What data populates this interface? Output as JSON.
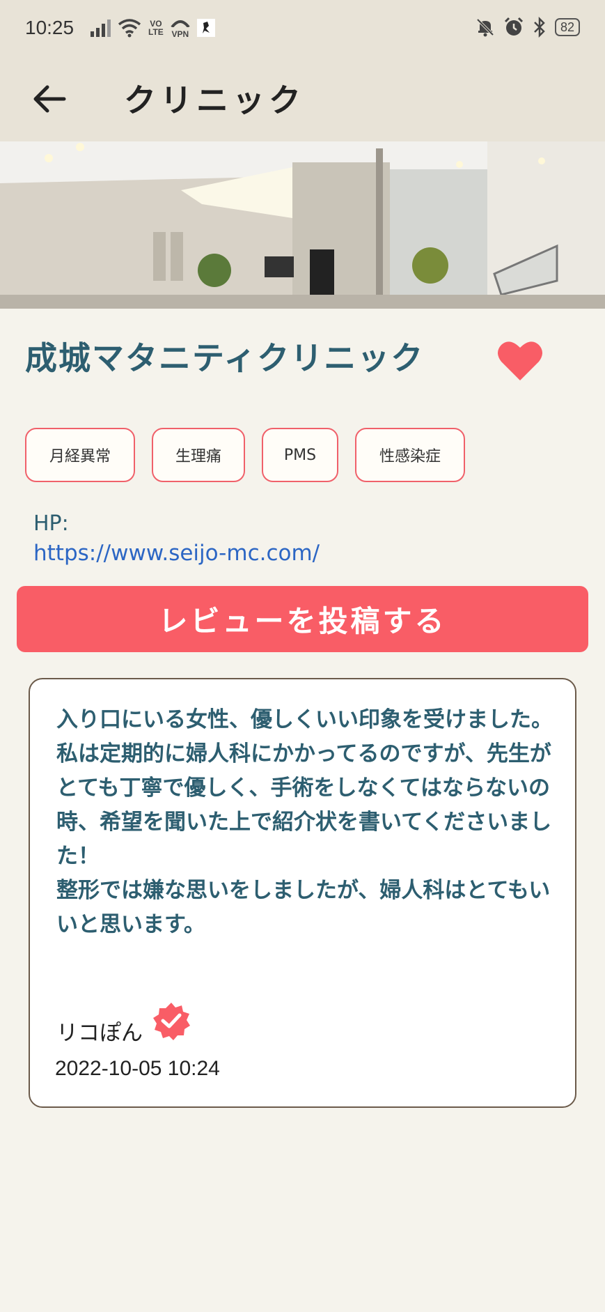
{
  "status_bar": {
    "time": "10:25",
    "volte_top": "VO",
    "volte_bottom": "LTE",
    "vpn": "VPN",
    "battery": "82"
  },
  "app_bar": {
    "title": "クリニック"
  },
  "clinic": {
    "name": "成城マタニティクリニック",
    "favorited": true,
    "tags": [
      "月経異常",
      "生理痛",
      "PMS",
      "性感染症"
    ],
    "hp_label": "HP:",
    "hp_url": "https://www.seijo-mc.com/"
  },
  "actions": {
    "post_review_label": "レビューを投稿する"
  },
  "review": {
    "text": "入り口にいる女性、優しくいい印象を受けました。\n私は定期的に婦人科にかかってるのですが、先生がとても丁寧で優しく、手術をしなくてはならないの時、希望を聞いた上で紹介状を書いてくださいました！\n整形では嫌な思いをしましたが、婦人科はとてもいいと思います。",
    "reviewer": "リコぽん",
    "verified": true,
    "date": "2022-10-05 10:24"
  },
  "colors": {
    "accent": "#f95d66",
    "heading": "#2d5e70",
    "link": "#2c66c4",
    "app_bar_bg": "#e8e3d7",
    "page_bg": "#f5f3ec"
  }
}
